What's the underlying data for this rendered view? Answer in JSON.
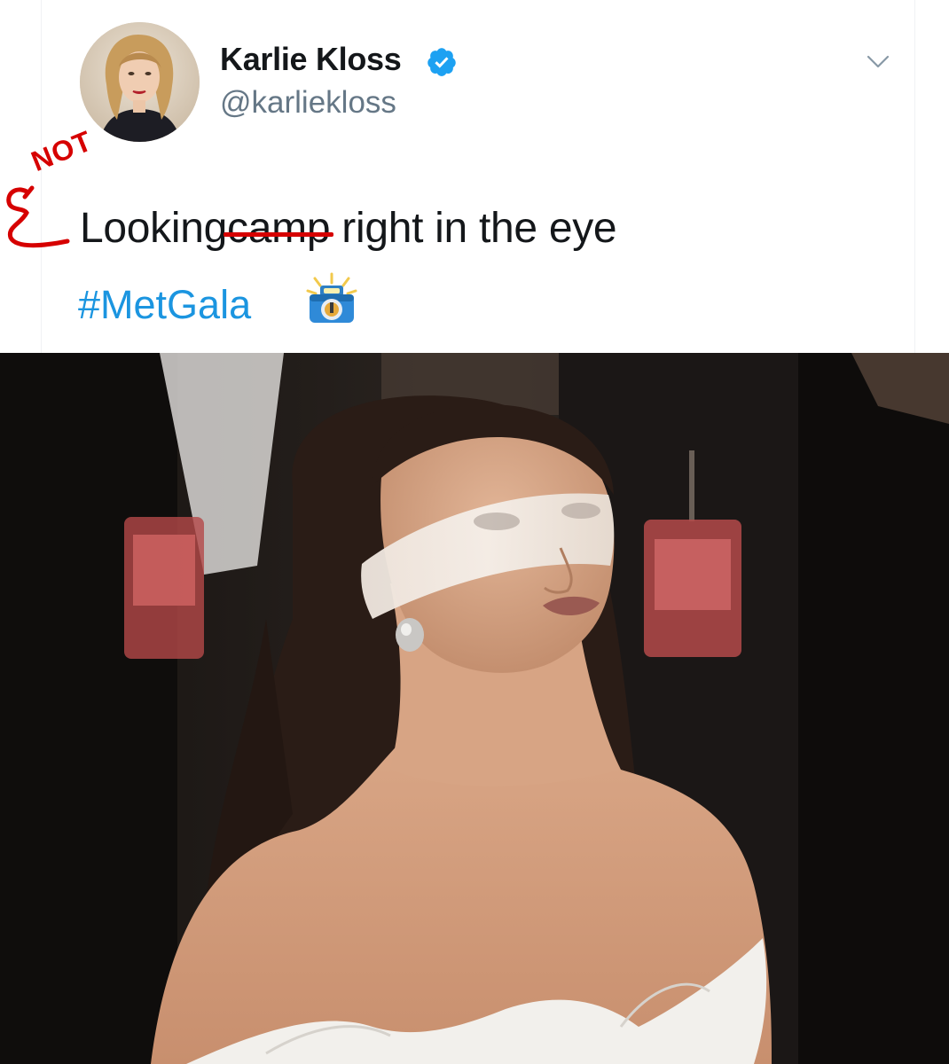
{
  "tweet": {
    "display_name": "Karlie Kloss",
    "handle": "@karliekloss",
    "text_before": "Looking ",
    "struck_word": "camp",
    "text_after": " right in the eye",
    "hashtag": "#MetGala",
    "annotation": "NOT",
    "verified_icon": "verified-badge-icon",
    "menu_icon": "chevron-down-icon",
    "emoji": "camera-flash-emoji",
    "colors": {
      "name": "#14171a",
      "handle": "#657786",
      "hashtag": "#1b95e0",
      "verified": "#1da1f2",
      "annotation": "#d60000"
    }
  },
  "photo": {
    "subject": "blindfolded-woman-photo"
  }
}
